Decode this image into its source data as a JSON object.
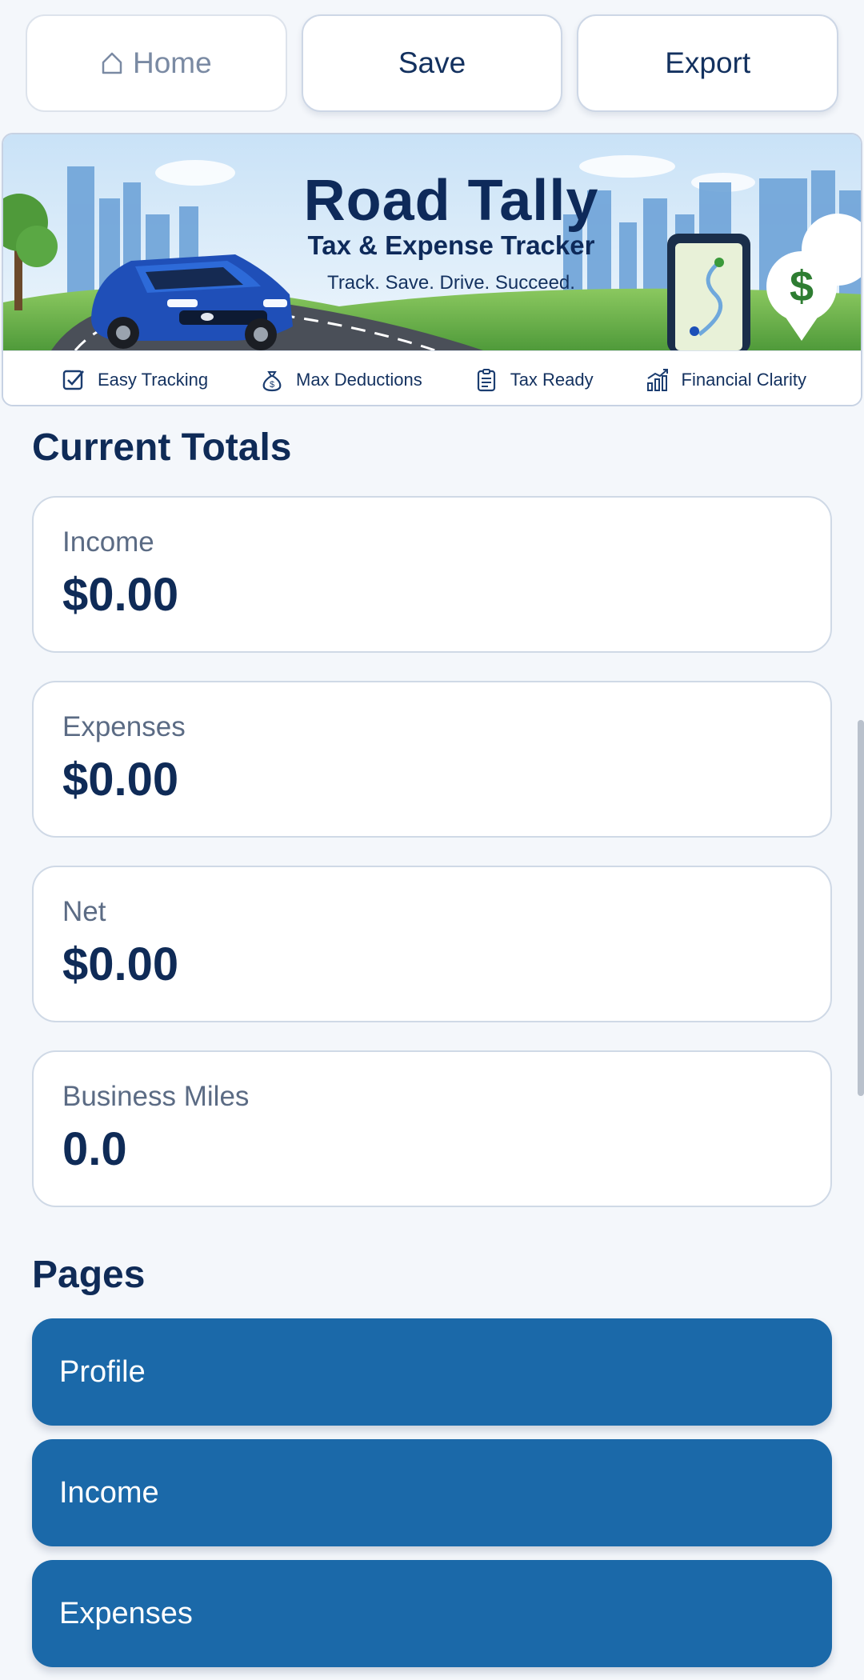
{
  "toolbar": {
    "home_label": "Home",
    "save_label": "Save",
    "export_label": "Export"
  },
  "banner": {
    "title": "Road Tally",
    "subtitle": "Tax & Expense Tracker",
    "tagline": "Track. Save. Drive. Succeed.",
    "features": [
      {
        "label": "Easy Tracking",
        "icon": "checkbox-icon"
      },
      {
        "label": "Max Deductions",
        "icon": "money-bag-icon"
      },
      {
        "label": "Tax Ready",
        "icon": "clipboard-icon"
      },
      {
        "label": "Financial Clarity",
        "icon": "growth-chart-icon"
      }
    ]
  },
  "totals": {
    "heading": "Current Totals",
    "cards": [
      {
        "label": "Income",
        "value": "$0.00"
      },
      {
        "label": "Expenses",
        "value": "$0.00"
      },
      {
        "label": "Net",
        "value": "$0.00"
      },
      {
        "label": "Business Miles",
        "value": "0.0"
      }
    ]
  },
  "pages": {
    "heading": "Pages",
    "items": [
      {
        "label": "Profile"
      },
      {
        "label": "Income"
      },
      {
        "label": "Expenses"
      }
    ]
  },
  "colors": {
    "primary_button": "#1b69a9",
    "heading_text": "#0f2b57",
    "page_background": "#f4f7fb",
    "dollar_green": "#2e7d32"
  }
}
